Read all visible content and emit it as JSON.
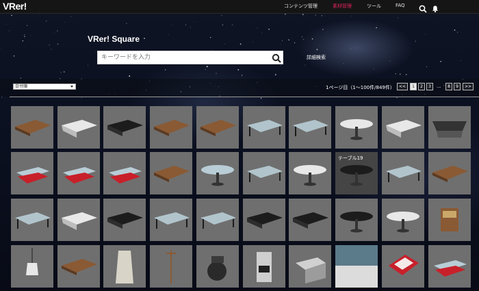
{
  "app": {
    "logo": "VRer!"
  },
  "nav": {
    "items": [
      {
        "label": "コンテンツ管理",
        "active": false
      },
      {
        "label": "素材管理",
        "active": true
      },
      {
        "label": "ツール",
        "active": false
      },
      {
        "label": "FAQ",
        "active": false
      }
    ],
    "icons": [
      "search-icon",
      "notification-bell-icon"
    ]
  },
  "hero": {
    "title": "VRer! Square",
    "search_placeholder": "キーワードを入力",
    "advanced_search": "詳細検索"
  },
  "toolbar": {
    "sort_selected": "日付順",
    "page_info": "1ページ目（1～100件/849件）",
    "pagination": {
      "prev": "<<",
      "pages_start": [
        "1",
        "2",
        "3"
      ],
      "ellipsis": "...",
      "pages_end": [
        "8",
        "9"
      ],
      "next": ">>",
      "current": "1"
    }
  },
  "grid": {
    "hovered_item_label": "テーブル19",
    "rows": [
      [
        "coffee-table-wood",
        "table-white-curved",
        "table-dark-low",
        "table-dark-wood",
        "table-dark-wood-2",
        "table-glass-black-frame",
        "table-glass-low",
        "table-round-white",
        "table-white-wave",
        "table-slatted-dark"
      ],
      [
        "bench-white-red",
        "table-red-glass",
        "table-red-slab",
        "table-white-wood",
        "table-round-glass-cross",
        "table-dark-glass-box",
        "table-round-white-tall",
        "table-round-dark",
        "table-glass-white-base",
        "table-wood-curved"
      ],
      [
        "table-glass-rect",
        "table-white-ribbon",
        "table-black-angular",
        "table-glass-steel",
        "table-glass-frame",
        "table-dark-slab-small",
        "table-angular-block",
        "table-oval-dark",
        "table-white-oval-ring",
        "cash-register"
      ],
      [
        "hanging-lamp",
        "wooden-board",
        "coat-hanging",
        "coat-rack",
        "coffee-pot",
        "coffee-machine",
        "sink-basin",
        "diner-scene",
        "menu-booklet",
        "red-booth-seat"
      ]
    ]
  },
  "colors": {
    "accent_nav": "#e0245e",
    "tile_bg": "#6f6f6f",
    "tile_hover": "#454545",
    "topbar_bg": "#151515"
  }
}
